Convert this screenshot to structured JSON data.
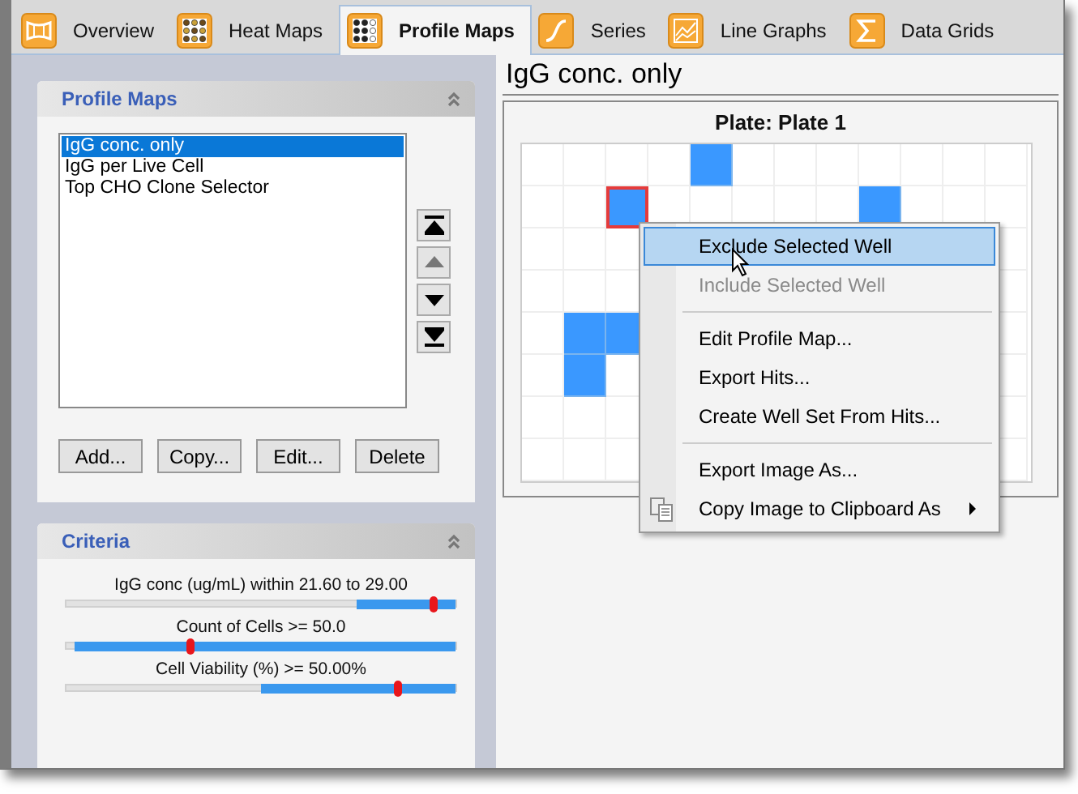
{
  "tabs": [
    {
      "label": "Overview",
      "selected": false
    },
    {
      "label": "Heat Maps",
      "selected": false
    },
    {
      "label": "Profile Maps",
      "selected": true
    },
    {
      "label": "Series",
      "selected": false
    },
    {
      "label": "Line Graphs",
      "selected": false
    },
    {
      "label": "Data Grids",
      "selected": false
    }
  ],
  "profile_maps_panel": {
    "title": "Profile Maps",
    "items": [
      {
        "label": "IgG conc. only",
        "selected": true
      },
      {
        "label": "IgG per Live Cell",
        "selected": false
      },
      {
        "label": "Top CHO Clone Selector",
        "selected": false
      }
    ],
    "move_buttons": [
      {
        "kind": "top",
        "disabled": false
      },
      {
        "kind": "up",
        "disabled": true
      },
      {
        "kind": "down",
        "disabled": false
      },
      {
        "kind": "bottom",
        "disabled": false
      }
    ],
    "buttons": [
      "Add...",
      "Copy...",
      "Edit...",
      "Delete"
    ]
  },
  "criteria_panel": {
    "title": "Criteria",
    "sliders": [
      {
        "label": "IgG conc (ug/mL) within 21.60 to 29.00",
        "level": 0.945,
        "highlight": {
          "level": 0.255
        }
      },
      {
        "label": "Count of Cells >= 50.0",
        "level": 0.32,
        "highlight": {
          "level": 0.98
        }
      },
      {
        "label": "Cell Viability (%) >= 50.00%",
        "level": 0.855,
        "highlight": {
          "level": 0.5
        }
      }
    ]
  },
  "profile_title": "IgG conc. only",
  "plate": {
    "title": "Plate: Plate 1",
    "rows": [
      {
        "wells": [
          {
            "hit": false,
            "selected": false
          },
          {
            "hit": false,
            "selected": false
          },
          {
            "hit": false,
            "selected": false
          },
          {
            "hit": false,
            "selected": false
          },
          {
            "hit": true,
            "selected": false
          },
          {
            "hit": false,
            "selected": false
          },
          {
            "hit": false,
            "selected": false
          },
          {
            "hit": false,
            "selected": false
          },
          {
            "hit": false,
            "selected": false
          },
          {
            "hit": false,
            "selected": false
          },
          {
            "hit": false,
            "selected": false
          },
          {
            "hit": false,
            "selected": false
          }
        ]
      },
      {
        "wells": [
          {
            "hit": false,
            "selected": false
          },
          {
            "hit": false,
            "selected": false
          },
          {
            "hit": true,
            "selected": true
          },
          {
            "hit": false,
            "selected": false
          },
          {
            "hit": false,
            "selected": false
          },
          {
            "hit": false,
            "selected": false
          },
          {
            "hit": false,
            "selected": false
          },
          {
            "hit": false,
            "selected": false
          },
          {
            "hit": true,
            "selected": false
          },
          {
            "hit": false,
            "selected": false
          },
          {
            "hit": false,
            "selected": false
          },
          {
            "hit": false,
            "selected": false
          }
        ]
      },
      {
        "wells": [
          {
            "hit": false,
            "selected": false
          },
          {
            "hit": false,
            "selected": false
          },
          {
            "hit": false,
            "selected": false
          }
        ],
        "wells_right": [
          {
            "hit": false,
            "selected": false
          }
        ]
      },
      {
        "wells": [
          {
            "hit": false,
            "selected": false
          },
          {
            "hit": false,
            "selected": false
          },
          {
            "hit": false,
            "selected": false
          }
        ],
        "wells_right": [
          {
            "hit": false,
            "selected": false
          }
        ]
      },
      {
        "wells": [
          {
            "hit": false,
            "selected": false
          },
          {
            "hit": true,
            "selected": false
          },
          {
            "hit": true,
            "selected": false
          }
        ],
        "wells_right": [
          {
            "hit": false,
            "selected": false
          }
        ]
      },
      {
        "wells": [
          {
            "hit": false,
            "selected": false
          },
          {
            "hit": true,
            "selected": false
          },
          {
            "hit": false,
            "selected": false
          }
        ],
        "wells_right": [
          {
            "hit": false,
            "selected": false
          }
        ]
      },
      {
        "wells": [
          {
            "hit": false,
            "selected": false
          },
          {
            "hit": false,
            "selected": false
          },
          {
            "hit": false,
            "selected": false
          }
        ],
        "wells_right": [
          {
            "hit": false,
            "selected": false
          }
        ]
      },
      {
        "wells": [
          {
            "hit": false,
            "selected": false
          },
          {
            "hit": false,
            "selected": false
          },
          {
            "hit": false,
            "selected": false
          }
        ],
        "wells_right": [
          {
            "hit": false,
            "selected": false
          }
        ]
      }
    ]
  },
  "context_menu": {
    "items": [
      {
        "kind": "item",
        "label": "Exclude Selected Well",
        "selected": true,
        "disabled": false
      },
      {
        "kind": "item",
        "label": "Include Selected Well",
        "selected": false,
        "disabled": true
      },
      {
        "kind": "separator"
      },
      {
        "kind": "item",
        "label": "Edit Profile Map...",
        "selected": false,
        "disabled": false
      },
      {
        "kind": "item",
        "label": "Export Hits...",
        "selected": false,
        "disabled": false
      },
      {
        "kind": "item",
        "label": "Create Well Set From Hits...",
        "selected": false,
        "disabled": false
      },
      {
        "kind": "separator"
      },
      {
        "kind": "item",
        "label": "Export Image As...",
        "selected": false,
        "disabled": false
      },
      {
        "kind": "submenu",
        "label": "Copy Image to Clipboard As",
        "selected": false,
        "disabled": false
      }
    ]
  }
}
